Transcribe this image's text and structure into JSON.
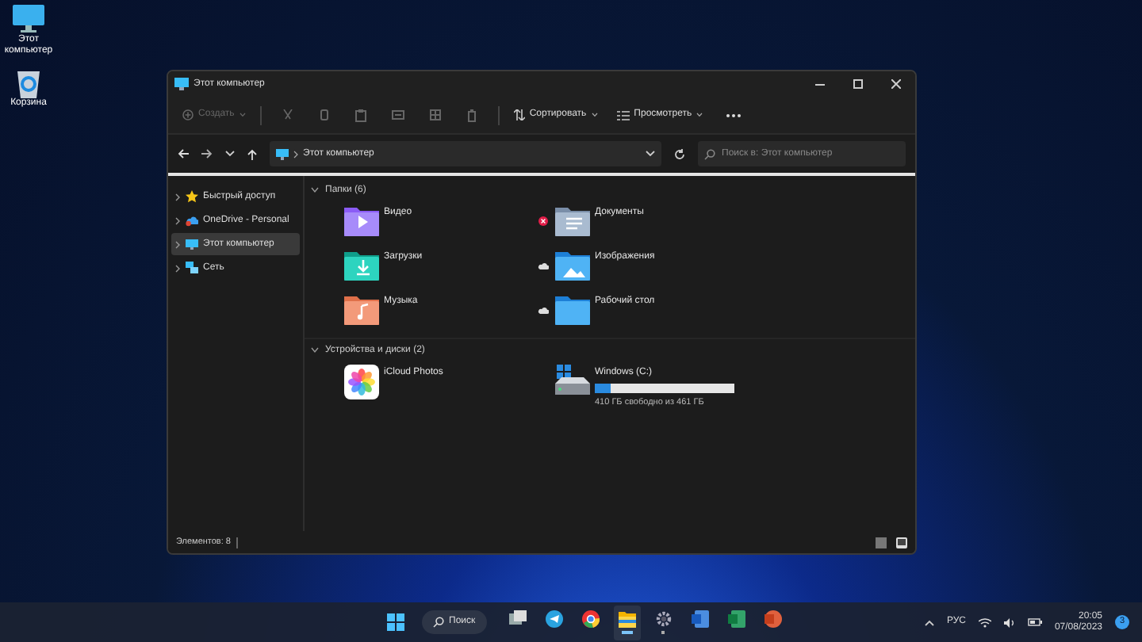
{
  "desktop_icons": [
    {
      "label": "Этот компьютер",
      "kind": "computer"
    },
    {
      "label": "Корзина",
      "kind": "recycle"
    }
  ],
  "window": {
    "title": "Этот компьютер"
  },
  "toolbar": {
    "new_button": {
      "label": "Создать",
      "disabled": true
    },
    "sort_button": "Сортировать",
    "view_button": "Просмотреть"
  },
  "address_bar": {
    "path": "Этот компьютер"
  },
  "search": {
    "placeholder": "Поиск в: Этот компьютер"
  },
  "sidebar": {
    "items": [
      {
        "label": "Быстрый доступ",
        "kind": "star",
        "selected": false
      },
      {
        "label": "OneDrive - Personal",
        "kind": "cloud",
        "selected": false
      },
      {
        "label": "Этот компьютер",
        "kind": "computer",
        "selected": true
      },
      {
        "label": "Сеть",
        "kind": "network",
        "selected": false
      }
    ]
  },
  "sections": [
    {
      "title": "Папки (6)",
      "items": [
        {
          "label": "Видео",
          "kind": "video",
          "sync_error": false,
          "cloud_only": false
        },
        {
          "label": "Документы",
          "kind": "documents",
          "sync_error": true,
          "cloud_only": false
        },
        {
          "label": "Загрузки",
          "kind": "downloads",
          "sync_error": false,
          "cloud_only": false
        },
        {
          "label": "Изображения",
          "kind": "images",
          "sync_error": false,
          "cloud_only": true
        },
        {
          "label": "Музыка",
          "kind": "music",
          "sync_error": false,
          "cloud_only": false
        },
        {
          "label": "Рабочий стол",
          "kind": "desktop",
          "sync_error": false,
          "cloud_only": true
        }
      ]
    },
    {
      "title": "Устройства и диски (2)",
      "items": [
        {
          "label": "iCloud Photos",
          "kind": "photos"
        },
        {
          "label": "Windows (C:)",
          "kind": "drive",
          "level": 0.11,
          "reading": "410 ГБ свободно из 461 ГБ"
        }
      ]
    }
  ],
  "status_bar": {
    "count": "Элементов: 8"
  },
  "taskbar": {
    "search_label": "Поиск",
    "apps": [
      {
        "kind": "taskview",
        "running": false,
        "active": false
      },
      {
        "kind": "telegram",
        "running": false,
        "active": false
      },
      {
        "kind": "chrome",
        "running": false,
        "active": false
      },
      {
        "kind": "explorer",
        "running": true,
        "active": true
      },
      {
        "kind": "settings",
        "running": true,
        "active": false
      },
      {
        "kind": "word",
        "running": false,
        "active": false
      },
      {
        "kind": "excel",
        "running": false,
        "active": false
      },
      {
        "kind": "powerpoint",
        "running": false,
        "active": false
      }
    ],
    "language": "РУС",
    "time": "20:05",
    "date": "07/08/2023",
    "notifications": "3"
  }
}
